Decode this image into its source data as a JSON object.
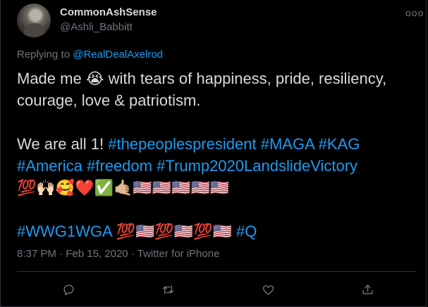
{
  "author": {
    "name": "CommonAshSense",
    "handle": "@Ashli_Babbitt"
  },
  "more_label": "ooo",
  "reply": {
    "prefix": "Replying to ",
    "to": "@RealDealAxelrod"
  },
  "tweet": {
    "line1_a": "Made me ",
    "line1_emoji": "😭",
    "line1_b": " with tears of happiness, pride, resiliency, courage, love & patriotism.",
    "line2_text": "We are all 1! ",
    "line2_tags": "#thepeoplespresident #MAGA #KAG #America #freedom #Trump2020LandslideVictory",
    "line3_emojis": "💯🙌🏻🥰❤️✅🤙🏼🇺🇸🇺🇸🇺🇸🇺🇸🇺🇸",
    "line4_tag1": "#WWG1WGA ",
    "line4_emojis": "💯🇺🇸💯🇺🇸💯🇺🇸",
    "line4_tag2": " #Q"
  },
  "meta": {
    "time": "8:37 PM",
    "sep1": " · ",
    "date": "Feb 15, 2020",
    "sep2": " · ",
    "source": "Twitter for iPhone"
  },
  "actions": {
    "reply_icon": "comment-icon",
    "retweet_icon": "retweet-icon",
    "like_icon": "heart-icon",
    "share_icon": "share-icon"
  },
  "colors": {
    "background": "#000000",
    "text": "#d9d9d9",
    "secondary": "#6e767d",
    "link": "#1d9bf0",
    "border": "#2f3336"
  }
}
